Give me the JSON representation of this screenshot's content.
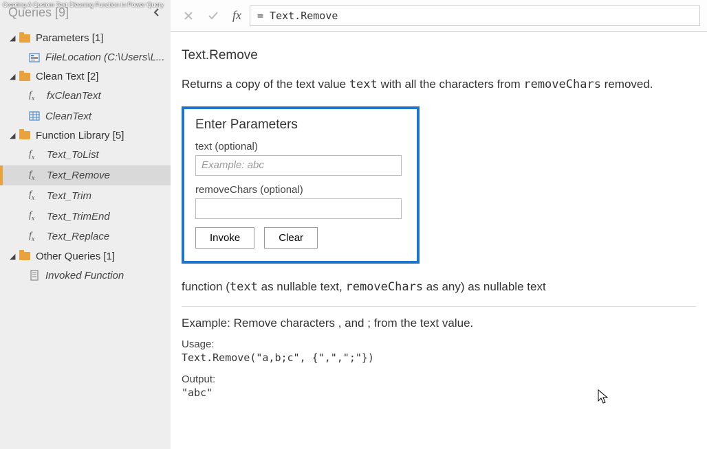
{
  "video": {
    "title": "Creating A Custom Text Cleaning Function In Power Query"
  },
  "sidebar": {
    "title": "Queries [9]",
    "groups": [
      {
        "label": "Parameters [1]",
        "items": [
          {
            "label": "FileLocation (C:\\Users\\L...",
            "type": "param"
          }
        ]
      },
      {
        "label": "Clean Text [2]",
        "items": [
          {
            "label": "fxCleanText",
            "type": "fx"
          },
          {
            "label": "CleanText",
            "type": "table"
          }
        ]
      },
      {
        "label": "Function Library [5]",
        "items": [
          {
            "label": "Text_ToList",
            "type": "fx"
          },
          {
            "label": "Text_Remove",
            "type": "fx",
            "selected": true
          },
          {
            "label": "Text_Trim",
            "type": "fx"
          },
          {
            "label": "Text_TrimEnd",
            "type": "fx"
          },
          {
            "label": "Text_Replace",
            "type": "fx"
          }
        ]
      },
      {
        "label": "Other Queries [1]",
        "items": [
          {
            "label": "Invoked Function",
            "type": "script"
          }
        ]
      }
    ]
  },
  "formula_bar": {
    "value": "= Text.Remove"
  },
  "function": {
    "name": "Text.Remove",
    "desc_pre": "Returns a copy of the text value ",
    "desc_code1": "text",
    "desc_mid": " with all the characters from ",
    "desc_code2": "removeChars",
    "desc_post": " removed.",
    "enter_params_title": "Enter Parameters",
    "params": [
      {
        "label": "text (optional)",
        "placeholder": "Example: abc"
      },
      {
        "label": "removeChars (optional)",
        "placeholder": ""
      }
    ],
    "buttons": {
      "invoke": "Invoke",
      "clear": "Clear"
    },
    "signature_pre": "function (",
    "signature_p1": "text",
    "signature_mid1": " as nullable text, ",
    "signature_p2": "removeChars",
    "signature_mid2": " as any) as nullable text",
    "example_title": "Example: Remove characters , and ; from the text value.",
    "usage_label": "Usage:",
    "usage_code": "Text.Remove(\"a,b;c\", {\",\",\";\"})",
    "output_label": "Output:",
    "output_code": "\"abc\""
  }
}
